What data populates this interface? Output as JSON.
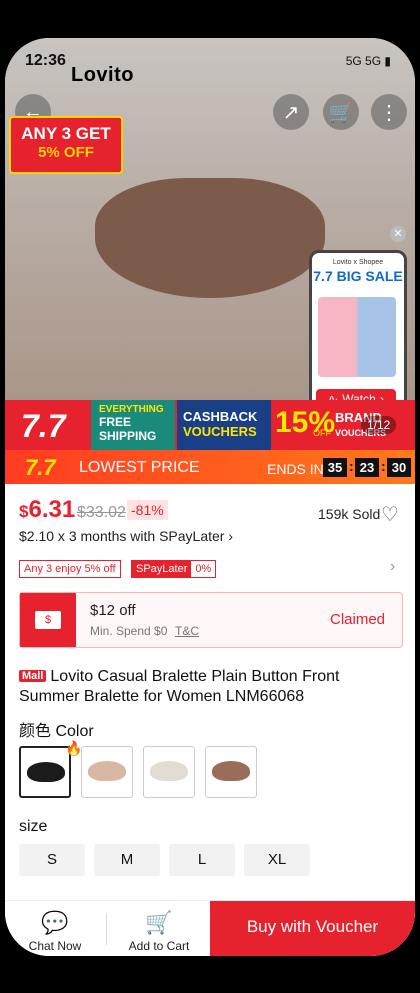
{
  "status_bar": {
    "time": "12:36",
    "icons": "5G 5G ▮"
  },
  "hero": {
    "logo": "Lovito",
    "promo_line1": "ANY 3 GET",
    "promo_line2": "5% OFF",
    "pager": "1/12"
  },
  "live": {
    "brand": "Lovito x Shopee",
    "sale": "7.7 BIG SALE",
    "watch": "Watch"
  },
  "campaign_banner": {
    "big77": "7.7",
    "free_shipping_top": "EVERYTHING",
    "free_shipping_bottom": "FREE SHIPPING",
    "cashback_top": "CASHBACK",
    "cashback_bottom": "VOUCHERS",
    "brand_pct": "15%",
    "brand_off": "OFF",
    "brand_top": "BRAND",
    "brand_bottom": "VOUCHERS"
  },
  "flash": {
    "label77": "7.7",
    "title": "LOWEST PRICE",
    "ends_in": "ENDS IN",
    "hh": "35",
    "mm": "23",
    "ss": "30"
  },
  "pricing": {
    "currency": "$",
    "price": "6.31",
    "original": "$33.02",
    "discount": "-81%",
    "sold": "159k Sold",
    "paylater": "$2.10 x 3 months with SPayLater ›"
  },
  "chips": {
    "any3": "Any 3 enjoy 5% off",
    "spaylater": "SPayLater",
    "spaylater_pct": "0%"
  },
  "voucher": {
    "ticket": "$",
    "amount": "$12 off",
    "min_spend": "Min. Spend $0",
    "tc": "T&C",
    "status": "Claimed"
  },
  "product": {
    "mall_tag": "Mall",
    "title": "Lovito Casual Bralette Plain Button Front Summer Bralette for Women LNM66068"
  },
  "variants": {
    "color_label": "颜色 Color",
    "colors": [
      "#1b1b1b",
      "#d8b8a2",
      "#e3dcd2",
      "#9a6d59"
    ],
    "size_label": "size",
    "sizes": [
      "S",
      "M",
      "L",
      "XL"
    ]
  },
  "bottom_bar": {
    "chat": "Chat Now",
    "cart": "Add to Cart",
    "buy": "Buy with Voucher"
  }
}
